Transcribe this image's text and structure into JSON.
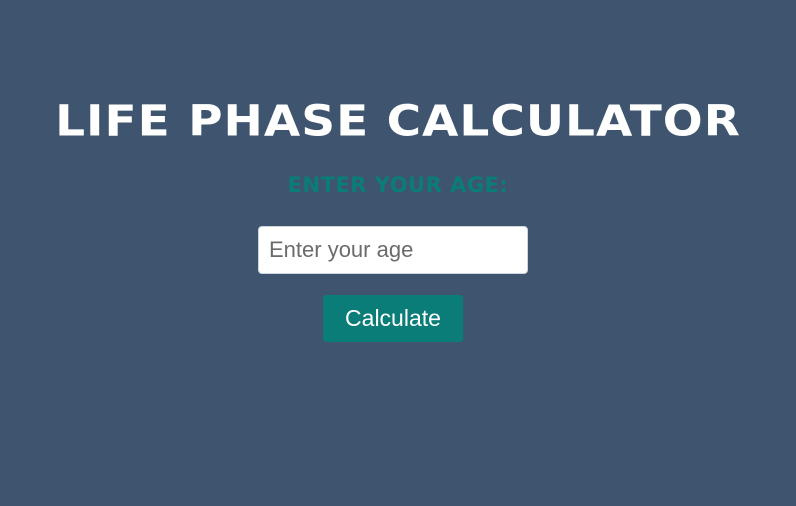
{
  "header": {
    "title": "LIFE PHASE CALCULATOR"
  },
  "form": {
    "label": "ENTER YOUR AGE:",
    "age_input": {
      "value": "",
      "placeholder": "Enter your age"
    },
    "calculate_label": "Calculate"
  },
  "colors": {
    "background": "#3e546f",
    "accent": "#0b7d78",
    "title_text": "#ffffff"
  }
}
